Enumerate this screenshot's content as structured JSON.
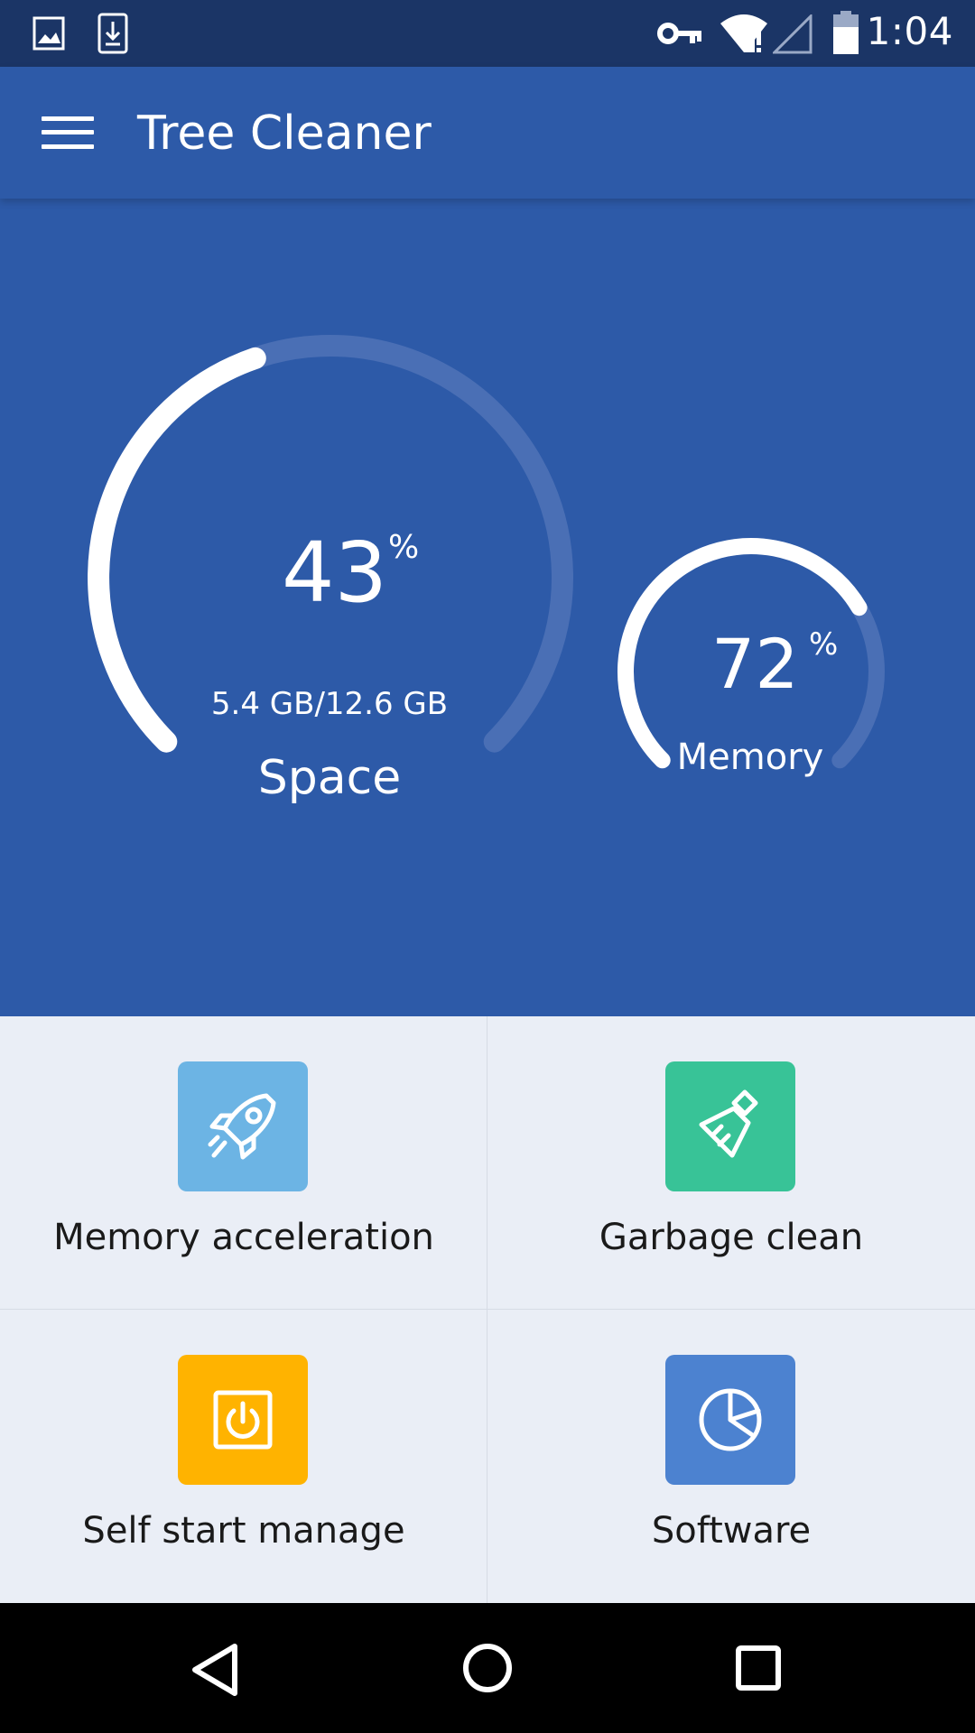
{
  "status_bar": {
    "time": "1:04",
    "left_icons": [
      "image-icon",
      "download-icon"
    ],
    "right_icons": [
      "vpn-key-icon",
      "wifi-alert-icon",
      "signal-icon",
      "battery-icon"
    ]
  },
  "app_bar": {
    "title": "Tree Cleaner",
    "menu_icon": "menu-icon"
  },
  "gauges": {
    "space": {
      "value": "43",
      "unit": "%",
      "detail": "5.4 GB/12.6 GB",
      "label": "Space",
      "fraction": 0.43
    },
    "memory": {
      "value": "72",
      "unit": "%",
      "label": "Memory",
      "fraction": 0.72
    }
  },
  "tiles": [
    {
      "label": "Memory acceleration",
      "icon": "rocket-icon",
      "color": "#6cb4e4"
    },
    {
      "label": "Garbage clean",
      "icon": "brush-icon",
      "color": "#38c397"
    },
    {
      "label": "Self start manage",
      "icon": "power-icon",
      "color": "#ffb300"
    },
    {
      "label": "Software",
      "icon": "pie-chart-icon",
      "color": "#4c82d0"
    }
  ],
  "nav_bar": {
    "icons": [
      "back-icon",
      "home-icon",
      "recents-icon"
    ]
  },
  "colors": {
    "status_bar": "#1b3566",
    "primary": "#2d5aa8",
    "grid_background": "#eaeef6",
    "gauge_track": "#4a6fb5",
    "gauge_fill": "#ffffff"
  }
}
